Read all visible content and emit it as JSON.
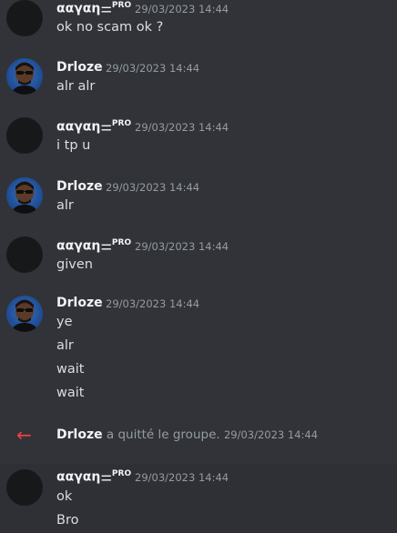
{
  "user_a": {
    "name": "ααγαη",
    "badge_glyph": "⚌",
    "badge": "PRO"
  },
  "user_b": {
    "name": "Drloze"
  },
  "messages": [
    {
      "author": "ααγαη",
      "timestamp": "29/03/2023 14:44",
      "lines": [
        "ok no scam ok ?"
      ]
    },
    {
      "author": "Drloze",
      "timestamp": "29/03/2023 14:44",
      "lines": [
        "alr alr"
      ]
    },
    {
      "author": "ααγαη",
      "timestamp": "29/03/2023 14:44",
      "lines": [
        "i tp u"
      ]
    },
    {
      "author": "Drloze",
      "timestamp": "29/03/2023 14:44",
      "lines": [
        "alr"
      ]
    },
    {
      "author": "ααγαη",
      "timestamp": "29/03/2023 14:44",
      "lines": [
        "given"
      ]
    },
    {
      "author": "Drloze",
      "timestamp": "29/03/2023 14:44",
      "lines": [
        "ye",
        "alr",
        "wait",
        "wait"
      ]
    },
    {
      "author": "ααγαη",
      "timestamp": "29/03/2023 14:44",
      "lines": [
        "ok",
        "Bro"
      ]
    }
  ],
  "system": {
    "arrow": "←",
    "name": "Drloze",
    "text": "a quitté le groupe.",
    "timestamp": "29/03/2023 14:44"
  }
}
